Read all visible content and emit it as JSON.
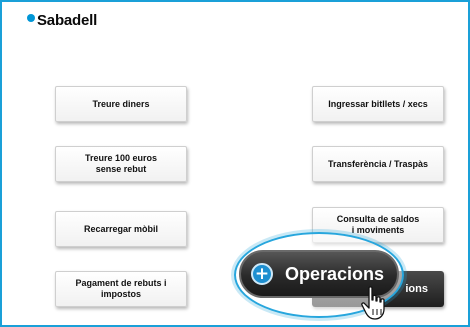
{
  "brand": {
    "name": "Sabadell",
    "color": "#0096d6"
  },
  "accent_color": "#1aa0d8",
  "menu": {
    "withdraw": "Treure diners",
    "withdraw_100": "Treure 100 euros\nsense rebut",
    "top_up_mobile": "Recarregar mòbil",
    "pay_bills": "Pagament de rebuts i\nimpostos",
    "deposit": "Ingressar bitllets / xecs",
    "transfer": "Transferència / Traspàs",
    "balance": "Consulta de saldos\ni moviments",
    "operations_partial": "ions"
  },
  "magnifier": {
    "label": "Operacions",
    "icon": "plus-circle-icon"
  },
  "cursor": {
    "icon": "hand-pointer-icon"
  }
}
